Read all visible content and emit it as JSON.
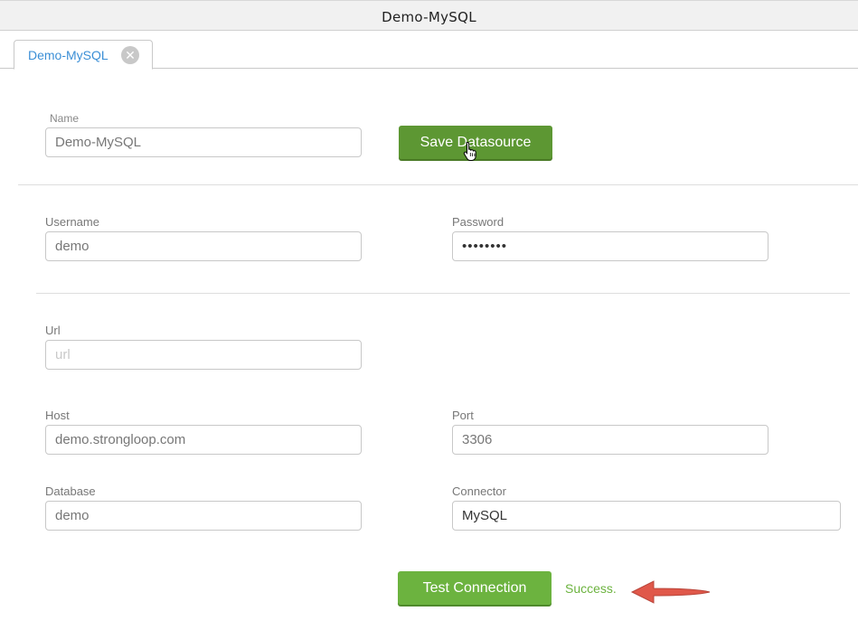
{
  "window": {
    "title": "Demo-MySQL"
  },
  "tab": {
    "label": "Demo-MySQL",
    "close_glyph": "✕"
  },
  "name": {
    "label": "Name",
    "value": "Demo-MySQL"
  },
  "save_button": {
    "label": "Save Datasource"
  },
  "username": {
    "label": "Username",
    "value": "demo"
  },
  "password": {
    "label": "Password",
    "value": "demopass"
  },
  "url": {
    "label": "Url",
    "value": "",
    "placeholder": "url"
  },
  "host": {
    "label": "Host",
    "value": "demo.strongloop.com"
  },
  "port": {
    "label": "Port",
    "value": "3306"
  },
  "database": {
    "label": "Database",
    "value": "demo"
  },
  "connector": {
    "label": "Connector",
    "value": "MySQL"
  },
  "test_button": {
    "label": "Test Connection"
  },
  "status": {
    "text": "Success.",
    "color": "#6cb33f"
  },
  "colors": {
    "accent_green": "#6cb33f",
    "save_green": "#5d9733",
    "tab_blue": "#3b8fd6",
    "annotation_red": "#e0584a"
  },
  "icons": {
    "cursor": "hand-pointer-icon",
    "annotation": "arrow-left-icon"
  }
}
